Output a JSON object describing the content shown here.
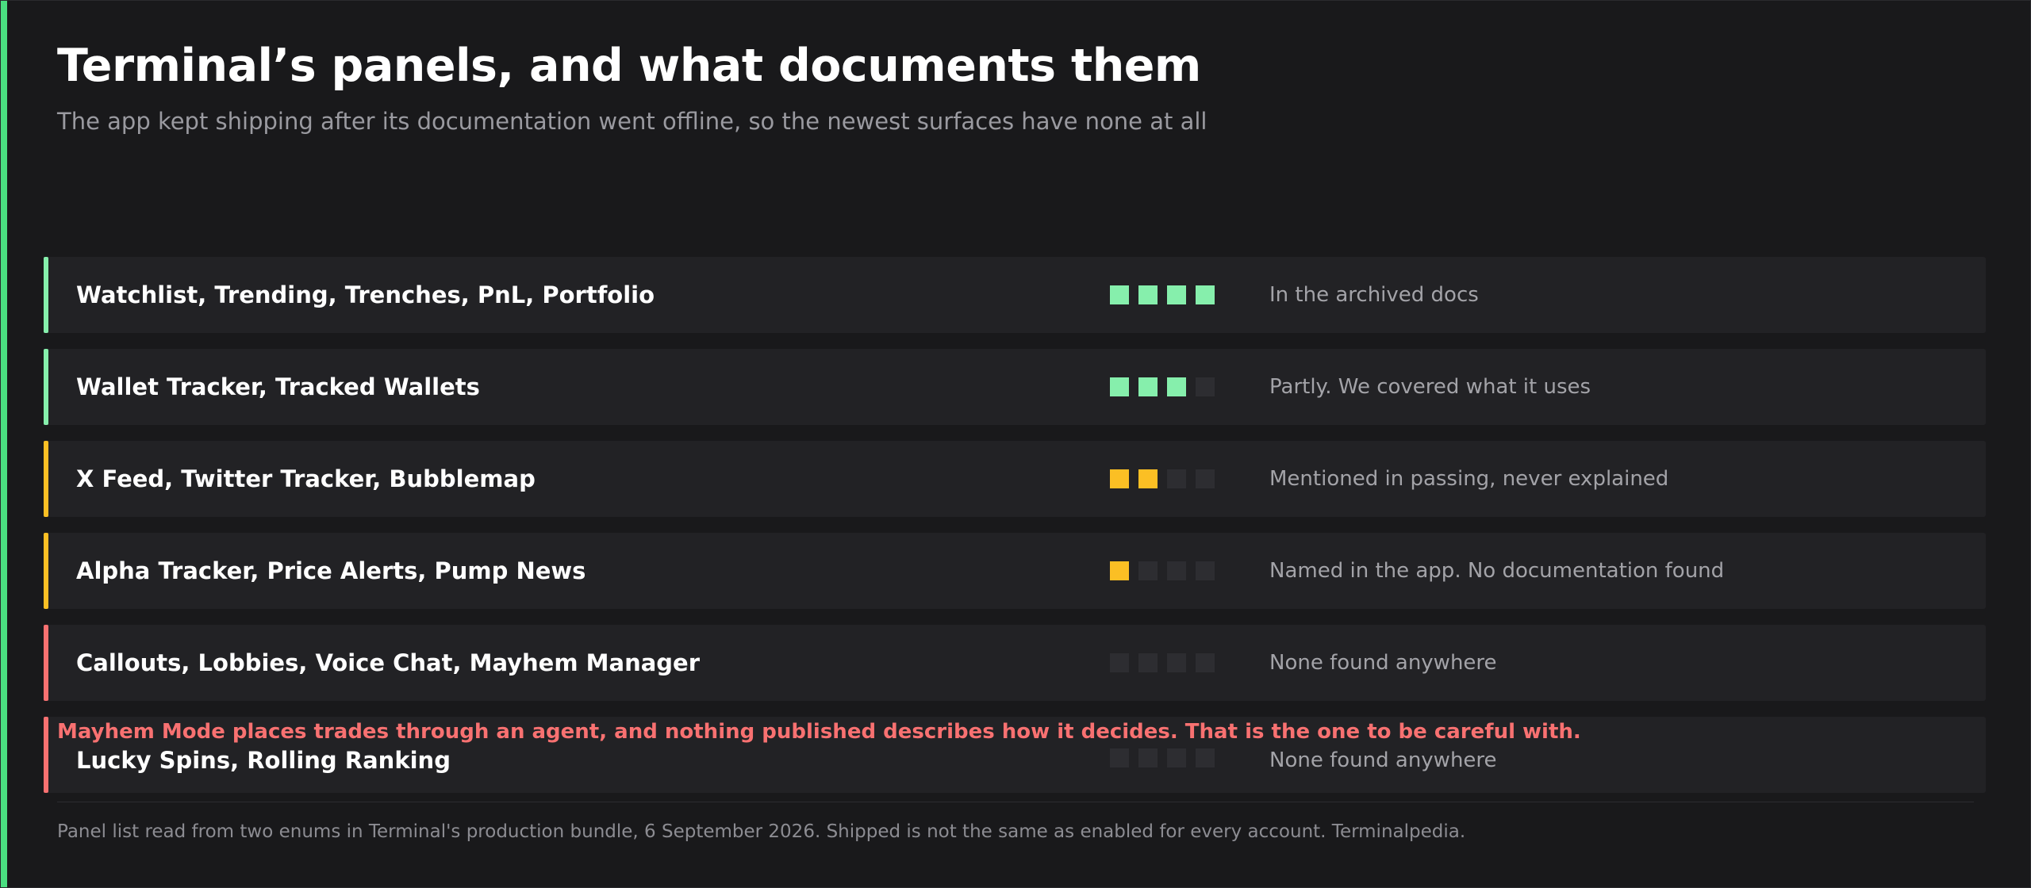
{
  "header": {
    "title": "Terminal’s panels, and what documents them",
    "subtitle": "The app kept shipping after its documentation went offline, so the newest surfaces have none at all"
  },
  "colors": {
    "green": "#86efac",
    "yellow": "#fbbf24",
    "red": "#f87171",
    "empty": "#2d2d31",
    "frame_accent": "#4ade80"
  },
  "rows": [
    {
      "label": "Watchlist, Trending, Trenches, PnL, Portfolio",
      "status": "In the archived docs",
      "level": 4,
      "color": "#86efac"
    },
    {
      "label": "Wallet Tracker, Tracked Wallets",
      "status": "Partly. We covered what it uses",
      "level": 3,
      "color": "#86efac"
    },
    {
      "label": "X Feed, Twitter Tracker, Bubblemap",
      "status": "Mentioned in passing, never explained",
      "level": 2,
      "color": "#fbbf24"
    },
    {
      "label": "Alpha Tracker, Price Alerts, Pump News",
      "status": "Named in the app. No documentation found",
      "level": 1,
      "color": "#fbbf24"
    },
    {
      "label": "Callouts, Lobbies, Voice Chat, Mayhem Manager",
      "status": "None found anywhere",
      "level": 0,
      "color": "#f87171"
    },
    {
      "label": "Lucky Spins, Rolling Ranking",
      "status": "None found anywhere",
      "level": 0,
      "color": "#f87171"
    }
  ],
  "level_max": 4,
  "warning": "Mayhem Mode places trades through an agent, and nothing published describes how it decides. That is the one to be careful with.",
  "footer": "Panel list read from two enums in Terminal's production bundle, 6 September 2026. Shipped is not the same as enabled for every account. Terminalpedia."
}
